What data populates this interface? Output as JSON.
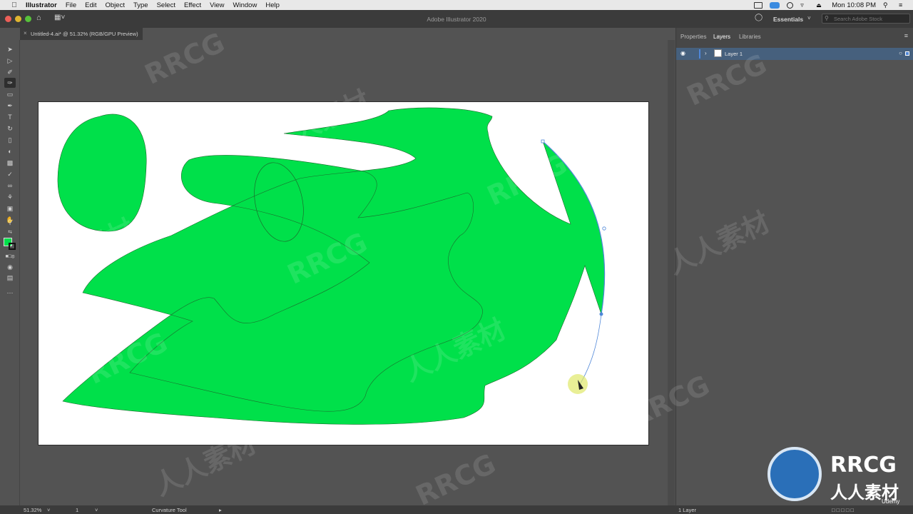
{
  "menubar": {
    "app_name": "Illustrator",
    "items": [
      "File",
      "Edit",
      "Object",
      "Type",
      "Select",
      "Effect",
      "View",
      "Window",
      "Help"
    ],
    "clock": "Mon 10:08 PM"
  },
  "titlebar": {
    "title": "Adobe Illustrator 2020",
    "workspace": "Essentials",
    "search_placeholder": "Search Adobe Stock"
  },
  "document": {
    "tab_label": "Untitled-4.ai* @ 51.32% (RGB/GPU Preview)"
  },
  "panel": {
    "tabs": [
      "Properties",
      "Layers",
      "Libraries"
    ],
    "active_tab": "Layers",
    "layers": [
      {
        "name": "Layer 1"
      }
    ],
    "layer_count": "1 Layer"
  },
  "statusbar": {
    "zoom": "51.32%",
    "artboard": "1",
    "tool": "Curvature Tool"
  },
  "colors": {
    "fill": "#00e04a",
    "selection": "#4f87d8",
    "highlight": "#e0e86a"
  },
  "watermark": {
    "text": "RRCG",
    "cn": "人人素材",
    "badge": "Udemy"
  }
}
